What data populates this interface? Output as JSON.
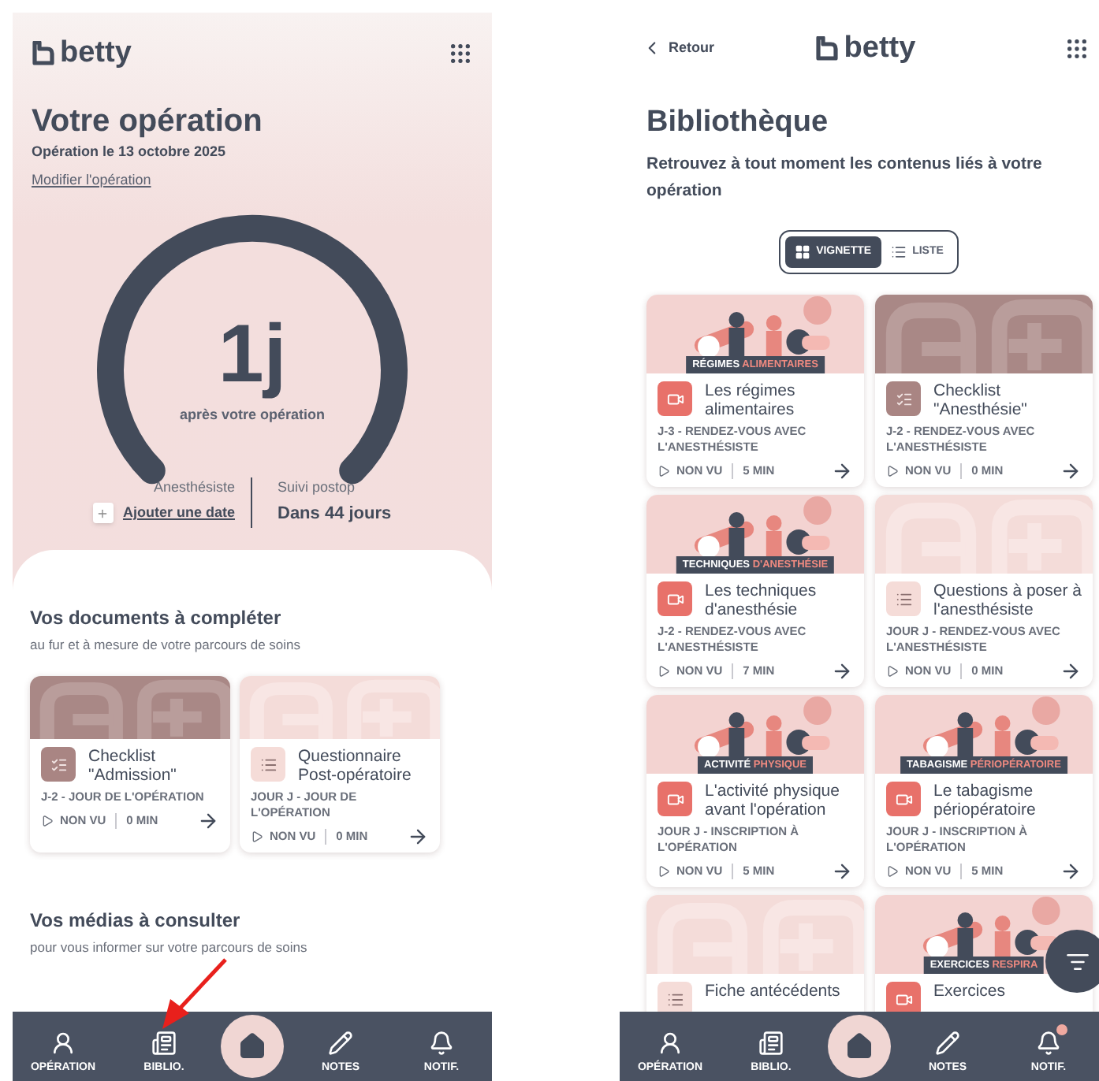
{
  "screens": [
    {
      "kind": "operation",
      "header": {
        "logo": "betty"
      },
      "title": "Votre opération",
      "subtitle": "Opération le 13 octobre 2025",
      "edit_link": "Modifier l'opération",
      "countdown": {
        "value": "1j",
        "caption": "après votre opération"
      },
      "milestones": [
        {
          "label": "Anesthésiste",
          "action": "Ajouter une date"
        },
        {
          "label": "Suivi postop",
          "value": "Dans 44 jours"
        }
      ],
      "sections": [
        {
          "title": "Vos documents à compléter",
          "subtitle": "au fur et à mesure de votre parcours de soins",
          "cards": [
            {
              "kind": "checklist",
              "title": "Checklist \"Admission\"",
              "meta": "J-2 - JOUR DE L'OPÉRATION",
              "status": "NON VU",
              "duration": "0 MIN"
            },
            {
              "kind": "questionnaire",
              "title": "Questionnaire Post-opératoire",
              "meta": "JOUR J - JOUR DE L'OPÉRATION",
              "status": "NON VU",
              "duration": "0 MIN"
            }
          ]
        },
        {
          "title": "Vos médias à consulter",
          "subtitle": "pour vous informer sur votre parcours de soins"
        }
      ],
      "nav": [
        {
          "kind": "operation",
          "label": "OPÉRATION"
        },
        {
          "kind": "library",
          "label": "BIBLIO."
        },
        {
          "kind": "home"
        },
        {
          "kind": "notes",
          "label": "NOTES"
        },
        {
          "kind": "notifications",
          "label": "NOTIF.",
          "badge": false
        }
      ]
    },
    {
      "kind": "library",
      "header": {
        "back": "Retour",
        "logo": "betty"
      },
      "title": "Bibliothèque",
      "description": "Retrouvez à tout moment les contenus liés à votre opération",
      "view_toggle": [
        {
          "kind": "grid",
          "label": "VIGNETTE",
          "selected": true
        },
        {
          "kind": "list",
          "label": "LISTE",
          "selected": false
        }
      ],
      "cards": [
        {
          "kind": "video",
          "image": {
            "caption": "RÉGIMES",
            "caption_accent": "ALIMENTAIRES"
          },
          "title": "Les régimes alimentaires",
          "meta": "J-3 - RENDEZ-VOUS AVEC L'ANESTHÉSISTE",
          "status": "NON VU",
          "duration": "5 MIN"
        },
        {
          "kind": "checklist",
          "title": "Checklist \"Anesthésie\"",
          "meta": "J-2 - RENDEZ-VOUS AVEC L'ANESTHÉSISTE",
          "status": "NON VU",
          "duration": "0 MIN"
        },
        {
          "kind": "video",
          "image": {
            "caption": "TECHNIQUES",
            "caption_accent": "D'ANESTHÉSIE"
          },
          "title": "Les techniques d'anesthésie",
          "meta": "J-2 - RENDEZ-VOUS AVEC L'ANESTHÉSISTE",
          "status": "NON VU",
          "duration": "7 MIN"
        },
        {
          "kind": "questionnaire",
          "title": "Questions à poser à l'anesthésiste",
          "meta": "JOUR J - RENDEZ-VOUS AVEC L'ANESTHÉSISTE",
          "status": "NON VU",
          "duration": "0 MIN"
        },
        {
          "kind": "video",
          "image": {
            "caption": "ACTIVITÉ",
            "caption_accent": "PHYSIQUE"
          },
          "title": "L'activité physique avant l'opération",
          "meta": "JOUR J - INSCRIPTION À L'OPÉRATION",
          "status": "NON VU",
          "duration": "5 MIN"
        },
        {
          "kind": "video",
          "image": {
            "caption": "TABAGISME",
            "caption_accent": "PÉRIOPÉRATOIRE"
          },
          "title": "Le tabagisme périopératoire",
          "meta": "JOUR J - INSCRIPTION À L'OPÉRATION",
          "status": "NON VU",
          "duration": "5 MIN"
        },
        {
          "kind": "questionnaire",
          "title": "Fiche antécédents"
        },
        {
          "kind": "video",
          "image": {
            "caption": "EXERCICES",
            "caption_accent": "RESPIRA"
          },
          "title": "Exercices"
        }
      ],
      "nav": [
        {
          "kind": "operation",
          "label": "OPÉRATION"
        },
        {
          "kind": "library",
          "label": "BIBLIO."
        },
        {
          "kind": "home"
        },
        {
          "kind": "notes",
          "label": "NOTES"
        },
        {
          "kind": "notifications",
          "label": "NOTIF.",
          "badge": true
        }
      ]
    }
  ]
}
